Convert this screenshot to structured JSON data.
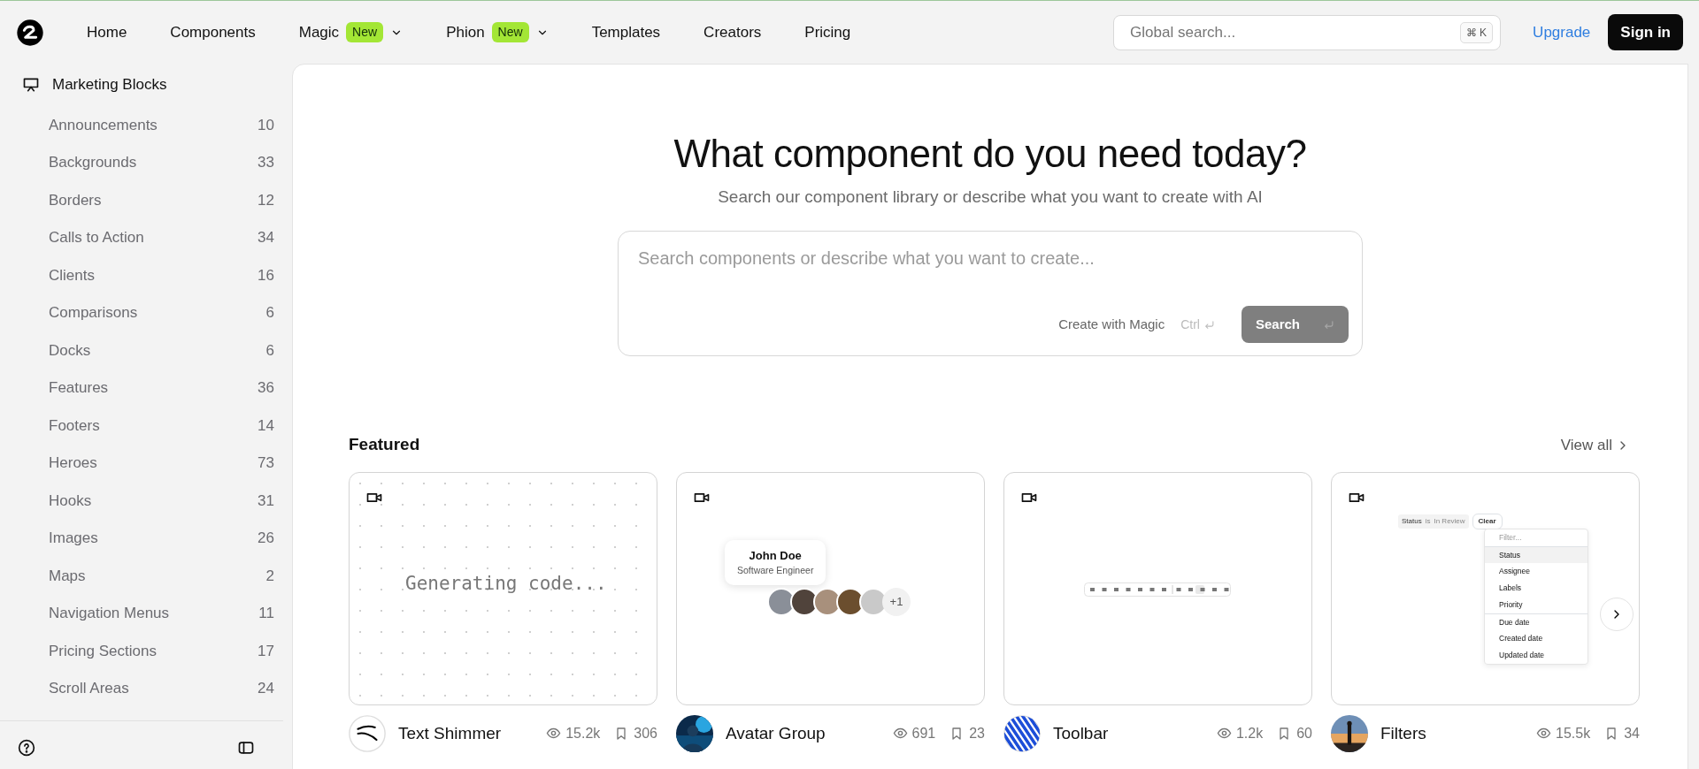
{
  "nav": {
    "items": [
      {
        "label": "Home"
      },
      {
        "label": "Components"
      },
      {
        "label": "Magic",
        "badge": "New",
        "dropdown": true
      },
      {
        "label": "Phion",
        "badge": "New",
        "dropdown": true
      },
      {
        "label": "Templates"
      },
      {
        "label": "Creators"
      },
      {
        "label": "Pricing"
      }
    ],
    "search": {
      "placeholder": "Global search...",
      "shortcut": "⌘ K"
    },
    "upgrade": "Upgrade",
    "sign_in": "Sign in"
  },
  "sidebar": {
    "section": "Marketing Blocks",
    "items": [
      {
        "label": "Announcements",
        "count": "10"
      },
      {
        "label": "Backgrounds",
        "count": "33"
      },
      {
        "label": "Borders",
        "count": "12"
      },
      {
        "label": "Calls to Action",
        "count": "34"
      },
      {
        "label": "Clients",
        "count": "16"
      },
      {
        "label": "Comparisons",
        "count": "6"
      },
      {
        "label": "Docks",
        "count": "6"
      },
      {
        "label": "Features",
        "count": "36"
      },
      {
        "label": "Footers",
        "count": "14"
      },
      {
        "label": "Heroes",
        "count": "73"
      },
      {
        "label": "Hooks",
        "count": "31"
      },
      {
        "label": "Images",
        "count": "26"
      },
      {
        "label": "Maps",
        "count": "2"
      },
      {
        "label": "Navigation Menus",
        "count": "11"
      },
      {
        "label": "Pricing Sections",
        "count": "17"
      },
      {
        "label": "Scroll Areas",
        "count": "24"
      }
    ]
  },
  "hero": {
    "title": "What component do you need today?",
    "subtitle": "Search our component library or describe what you want to create with AI",
    "placeholder": "Search components or describe what you want to create...",
    "magic": "Create with Magic",
    "shortcut": "Ctrl",
    "button": "Search"
  },
  "featured": {
    "title": "Featured",
    "view_all": "View all",
    "cards": [
      {
        "kind": "shimmer",
        "name": "Text Shimmer",
        "views": "15.2k",
        "saves": "306",
        "avatar": {
          "kind": "logo"
        },
        "preview": {
          "text": "Generating code..."
        }
      },
      {
        "kind": "avatars",
        "name": "Avatar Group",
        "views": "691",
        "saves": "23",
        "preview": {
          "name": "John Doe",
          "role": "Software Engineer",
          "more": "+1"
        }
      },
      {
        "kind": "toolbar",
        "name": "Toolbar",
        "views": "1.2k",
        "saves": "60",
        "avatar": {
          "kind": "stripes"
        }
      },
      {
        "kind": "filters",
        "name": "Filters",
        "views": "15.5k",
        "saves": "34",
        "preview": {
          "field": "Status",
          "op": "is",
          "value": "In Review",
          "clear": "Clear",
          "filter_placeholder": "Filter...",
          "options": [
            {
              "label": "Status",
              "selected": true
            },
            {
              "label": "Assignee",
              "selected": false
            },
            {
              "label": "Labels",
              "selected": false
            },
            {
              "label": "Priority",
              "selected": false
            }
          ],
          "date_options": [
            "Due date",
            "Created date",
            "Updated date"
          ]
        }
      }
    ]
  }
}
